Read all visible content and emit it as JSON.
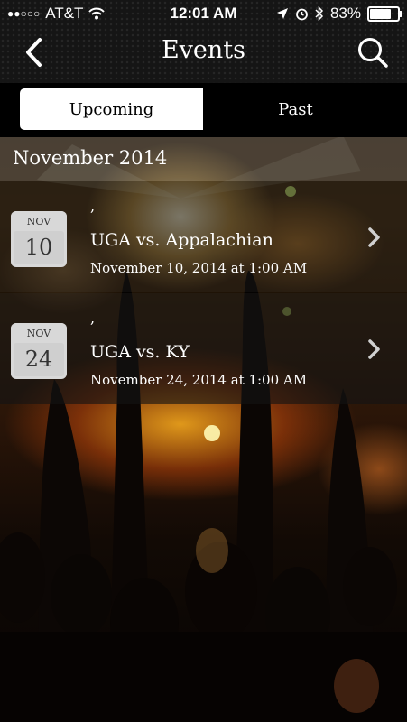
{
  "status_bar": {
    "signal": "●●○○○",
    "carrier": "AT&T",
    "time": "12:01 AM",
    "battery": "83%",
    "battery_fraction": 0.83
  },
  "header": {
    "title": "Events",
    "back_icon": "chevron-left-icon",
    "search_icon": "magnifier-icon"
  },
  "tabs": [
    {
      "label": "Upcoming",
      "selected": true
    },
    {
      "label": "Past",
      "selected": false
    }
  ],
  "section": {
    "title": "November 2014"
  },
  "events": [
    {
      "month": "NOV",
      "day": "10",
      "prefix": ",",
      "title": "UGA vs. Appalachian",
      "datetime": "November 10, 2014 at 1:00 AM"
    },
    {
      "month": "NOV",
      "day": "24",
      "prefix": ",",
      "title": "UGA vs. KY",
      "datetime": "November 24, 2014 at 1:00 AM"
    }
  ]
}
